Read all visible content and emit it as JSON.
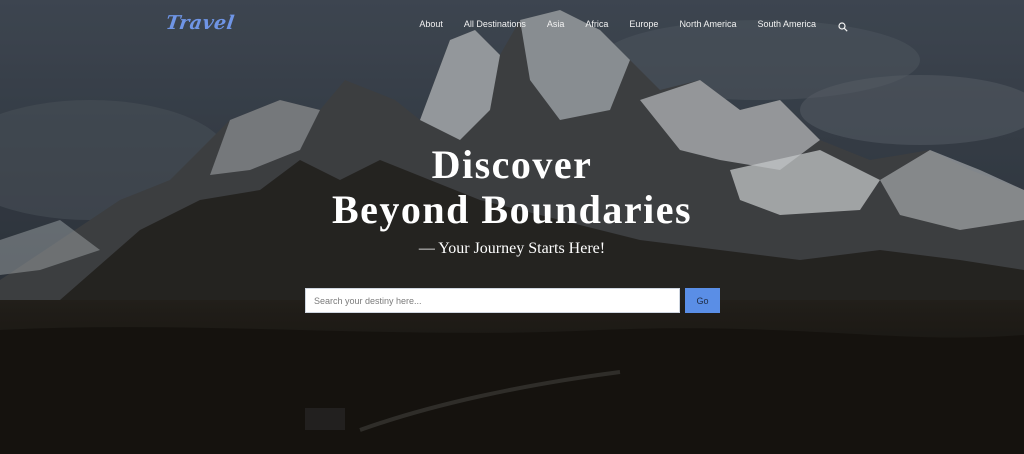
{
  "brand": {
    "logo_text": "Travel",
    "logo_color": "#6f95e6"
  },
  "nav": {
    "items": [
      {
        "label": "About"
      },
      {
        "label": "All Destinations"
      },
      {
        "label": "Asia"
      },
      {
        "label": "Africa"
      },
      {
        "label": "Europe"
      },
      {
        "label": "North America"
      },
      {
        "label": "South America"
      }
    ],
    "search_icon": "search-icon"
  },
  "hero": {
    "headline_line1": "Discover",
    "headline_line2": "Beyond Boundaries",
    "tagline": "— Your Journey Starts Here!",
    "background": "snowy-mountain-range-photo"
  },
  "search": {
    "placeholder": "Search your destiny here...",
    "value": "",
    "button_label": "Go",
    "button_color": "#5a8ee6"
  }
}
